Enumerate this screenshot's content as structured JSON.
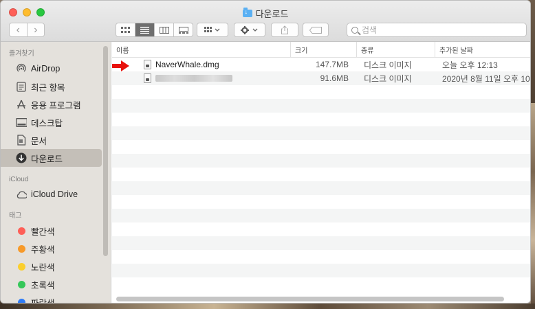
{
  "window": {
    "title": "다운로드"
  },
  "toolbar": {
    "search_placeholder": "검색"
  },
  "sidebar": {
    "favorites_header": "즐겨찾기",
    "favorites": [
      {
        "label": "AirDrop",
        "icon": "airdrop-icon"
      },
      {
        "label": "최근 항목",
        "icon": "recents-icon"
      },
      {
        "label": "응용 프로그램",
        "icon": "applications-icon"
      },
      {
        "label": "데스크탑",
        "icon": "desktop-icon"
      },
      {
        "label": "문서",
        "icon": "documents-icon"
      },
      {
        "label": "다운로드",
        "icon": "downloads-icon"
      }
    ],
    "icloud_header": "iCloud",
    "icloud": [
      {
        "label": "iCloud Drive",
        "icon": "cloud-icon"
      }
    ],
    "tags_header": "태그",
    "tags": [
      {
        "label": "빨간색",
        "color": "#fe5f57"
      },
      {
        "label": "주황색",
        "color": "#f79a2a"
      },
      {
        "label": "노란색",
        "color": "#fbcf2e"
      },
      {
        "label": "초록색",
        "color": "#35c759"
      },
      {
        "label": "파란색",
        "color": "#2f7cf6"
      }
    ]
  },
  "columns": {
    "name": "이름",
    "size": "크기",
    "kind": "종류",
    "date": "추가된 날짜"
  },
  "files": [
    {
      "name": "NaverWhale.dmg",
      "size": "147.7MB",
      "kind": "디스크 이미지",
      "date": "오늘 오후 12:13"
    },
    {
      "name": "",
      "size": "91.6MB",
      "kind": "디스크 이미지",
      "date": "2020년 8월 11일 오후 10:"
    }
  ],
  "colors": {
    "arrow": "#e8120c",
    "selection": "#c4bfb8"
  }
}
